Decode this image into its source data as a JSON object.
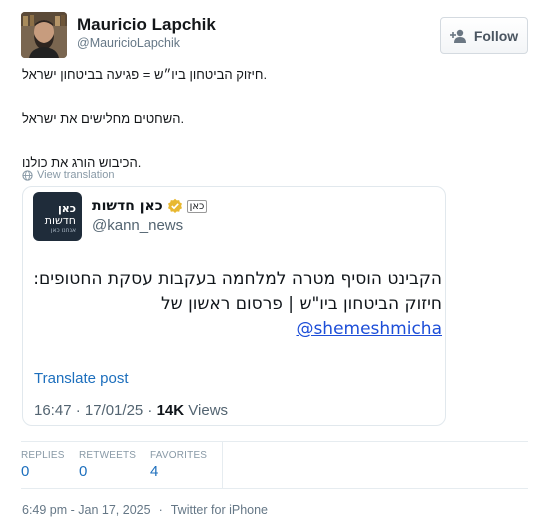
{
  "user": {
    "display_name": "Mauricio Lapchik",
    "handle": "@MauricioLapchik",
    "follow_label": "Follow"
  },
  "tweet": {
    "lines": [
      "חיזוק הביטחון ביו״ש = פגיעה בביטחון ישראל.",
      "השחטים מחלישים את ישראל.",
      "הכיבוש הורג את כולנו."
    ],
    "view_translation": "View translation"
  },
  "quote": {
    "avatar_text_1": "כאן",
    "avatar_text_2": "חדשות",
    "avatar_text_3": "אנחנו כאן",
    "name": "כאן חדשות",
    "badge": "כאן",
    "handle": "@kann_news",
    "body_line_1": "הקבינט הוסיף מטרה למלחמה בעקבות עסקת החטופים:",
    "body_line_2": "חיזוק הביטחון ביו\"ש | פרסום ראשון של",
    "mention": "@shemeshmicha",
    "translate_label": "Translate post",
    "time": "16:47 · 17/01/25 · ",
    "views_count": "14K",
    "views_label": " Views"
  },
  "stats": {
    "replies_label": "REPLIES",
    "replies_value": "0",
    "retweets_label": "RETWEETS",
    "retweets_value": "0",
    "favorites_label": "FAVORITES",
    "favorites_value": "4"
  },
  "footer": {
    "timestamp": "6:49 pm - Jan 17, 2025",
    "separator": "·",
    "source": "Twitter for iPhone"
  },
  "colors": {
    "link": "#1d6fbd",
    "verified": "#e8b830"
  }
}
